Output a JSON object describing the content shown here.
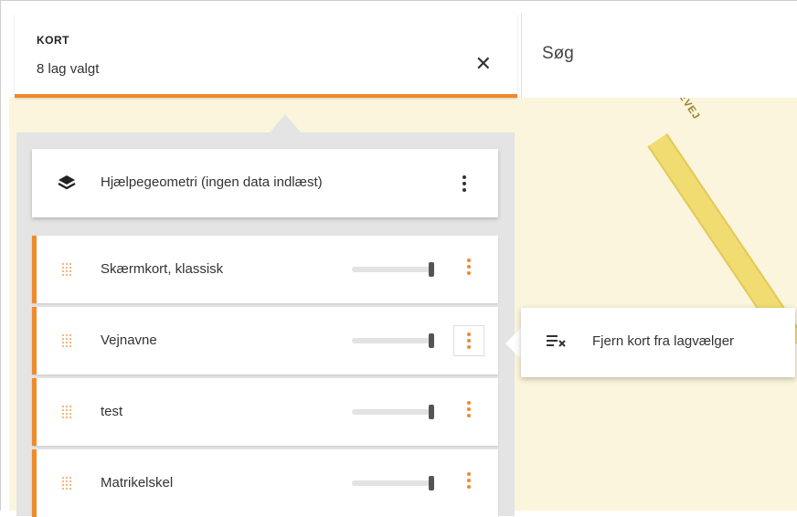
{
  "kort": {
    "title": "KORT",
    "subtitle": "8 lag valgt",
    "close_icon": "close-icon"
  },
  "search": {
    "placeholder": "Søg",
    "value": ""
  },
  "map": {
    "road_label": "EVEJ",
    "background_color": "#fbf5dd",
    "road_color": "#f1dc72"
  },
  "accent_color": "#f08a2c",
  "helper": {
    "icon": "layers-icon",
    "label": "Hjælpegeometri (ingen data indlæst)"
  },
  "layers": [
    {
      "label": "Skærmkort, klassisk",
      "opacity_percent": 100
    },
    {
      "label": "Vejnavne",
      "opacity_percent": 100
    },
    {
      "label": "test",
      "opacity_percent": 100
    },
    {
      "label": "Matrikelskel",
      "opacity_percent": 100
    }
  ],
  "popover": {
    "icon": "clear-list-icon",
    "label": "Fjern kort fra lagvælger"
  }
}
